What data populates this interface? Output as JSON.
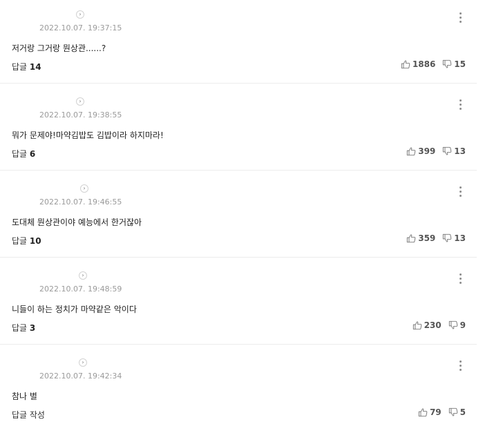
{
  "comments": [
    {
      "timestamp": "2022.10.07. 19:37:15",
      "text": "저거랑 그거랑 뭔상관......?",
      "reply_label": "답글",
      "reply_count": "14",
      "likes": "1886",
      "dislikes": "15"
    },
    {
      "timestamp": "2022.10.07. 19:38:55",
      "text": "뭐가 문제야!마약김밥도 김밥이라 하지마라!",
      "reply_label": "답글",
      "reply_count": "6",
      "likes": "399",
      "dislikes": "13"
    },
    {
      "timestamp": "2022.10.07. 19:46:55",
      "text": "도대체 뭔상관이야 예능에서 한거잖아",
      "reply_label": "답글",
      "reply_count": "10",
      "likes": "359",
      "dislikes": "13"
    },
    {
      "timestamp": "2022.10.07. 19:48:59",
      "text": "니들이 하는 정치가 마약같은 악이다",
      "reply_label": "답글",
      "reply_count": "3",
      "likes": "230",
      "dislikes": "9"
    },
    {
      "timestamp": "2022.10.07. 19:42:34",
      "text": "참나 별",
      "reply_label": "답글 작성",
      "reply_count": "",
      "likes": "79",
      "dislikes": "5"
    }
  ],
  "icons": {
    "profile_arrow": "chevron-right-icon",
    "more": "more-vertical-icon",
    "like": "thumbs-up-icon",
    "dislike": "thumbs-down-icon"
  },
  "colors": {
    "timestamp": "#9a9a9a",
    "text": "#222222",
    "separator": "#ececec",
    "icon": "#8c8c8c"
  }
}
